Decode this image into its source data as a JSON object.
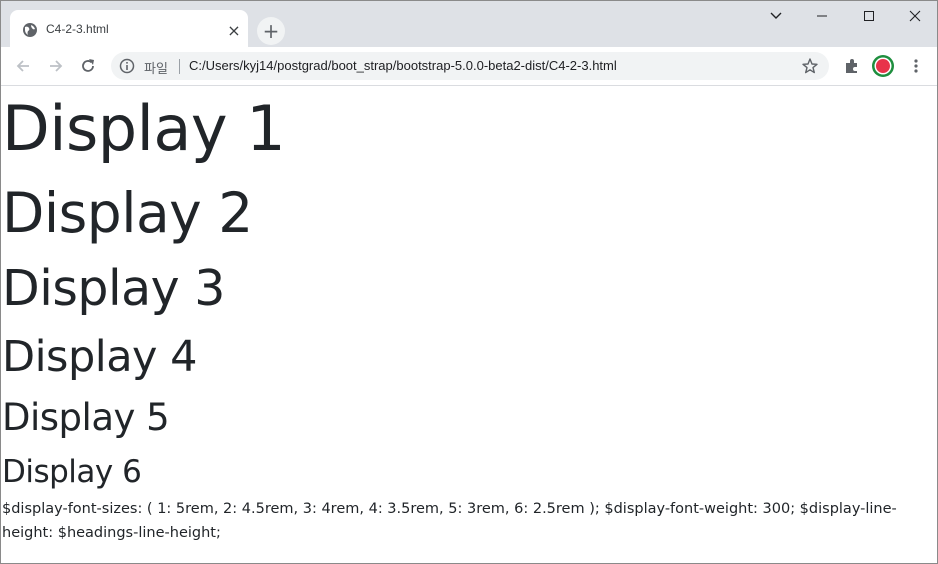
{
  "browser": {
    "tab_title": "C4-2-3.html",
    "tab_close": "×",
    "new_tab": "+",
    "scheme_label": "파일",
    "url": "C:/Users/kyj14/postgrad/boot_strap/bootstrap-5.0.0-beta2-dist/C4-2-3.html"
  },
  "page": {
    "display_1": "Display 1",
    "display_2": "Display 2",
    "display_3": "Display 3",
    "display_4": "Display 4",
    "display_5": "Display 5",
    "display_6": "Display 6",
    "note": "$display-font-sizes: ( 1: 5rem, 2: 4.5rem, 3: 4rem, 4: 3.5rem, 5: 3rem, 6: 2.5rem ); $display-font-weight: 300; $display-line-height: $headings-line-height;"
  },
  "icons": {
    "favicon": "globe-icon",
    "back": "arrow-left-icon",
    "forward": "arrow-right-icon",
    "reload": "reload-icon",
    "info": "info-icon",
    "bookmark": "star-icon",
    "extensions": "puzzle-icon",
    "profile": "avatar-icon",
    "menu": "kebab-menu-icon"
  },
  "colors": {
    "tabstrip": "#dee1e6",
    "text": "#212529",
    "profile_ring": "#1e8e3e",
    "profile_fill": "#e8334a"
  }
}
